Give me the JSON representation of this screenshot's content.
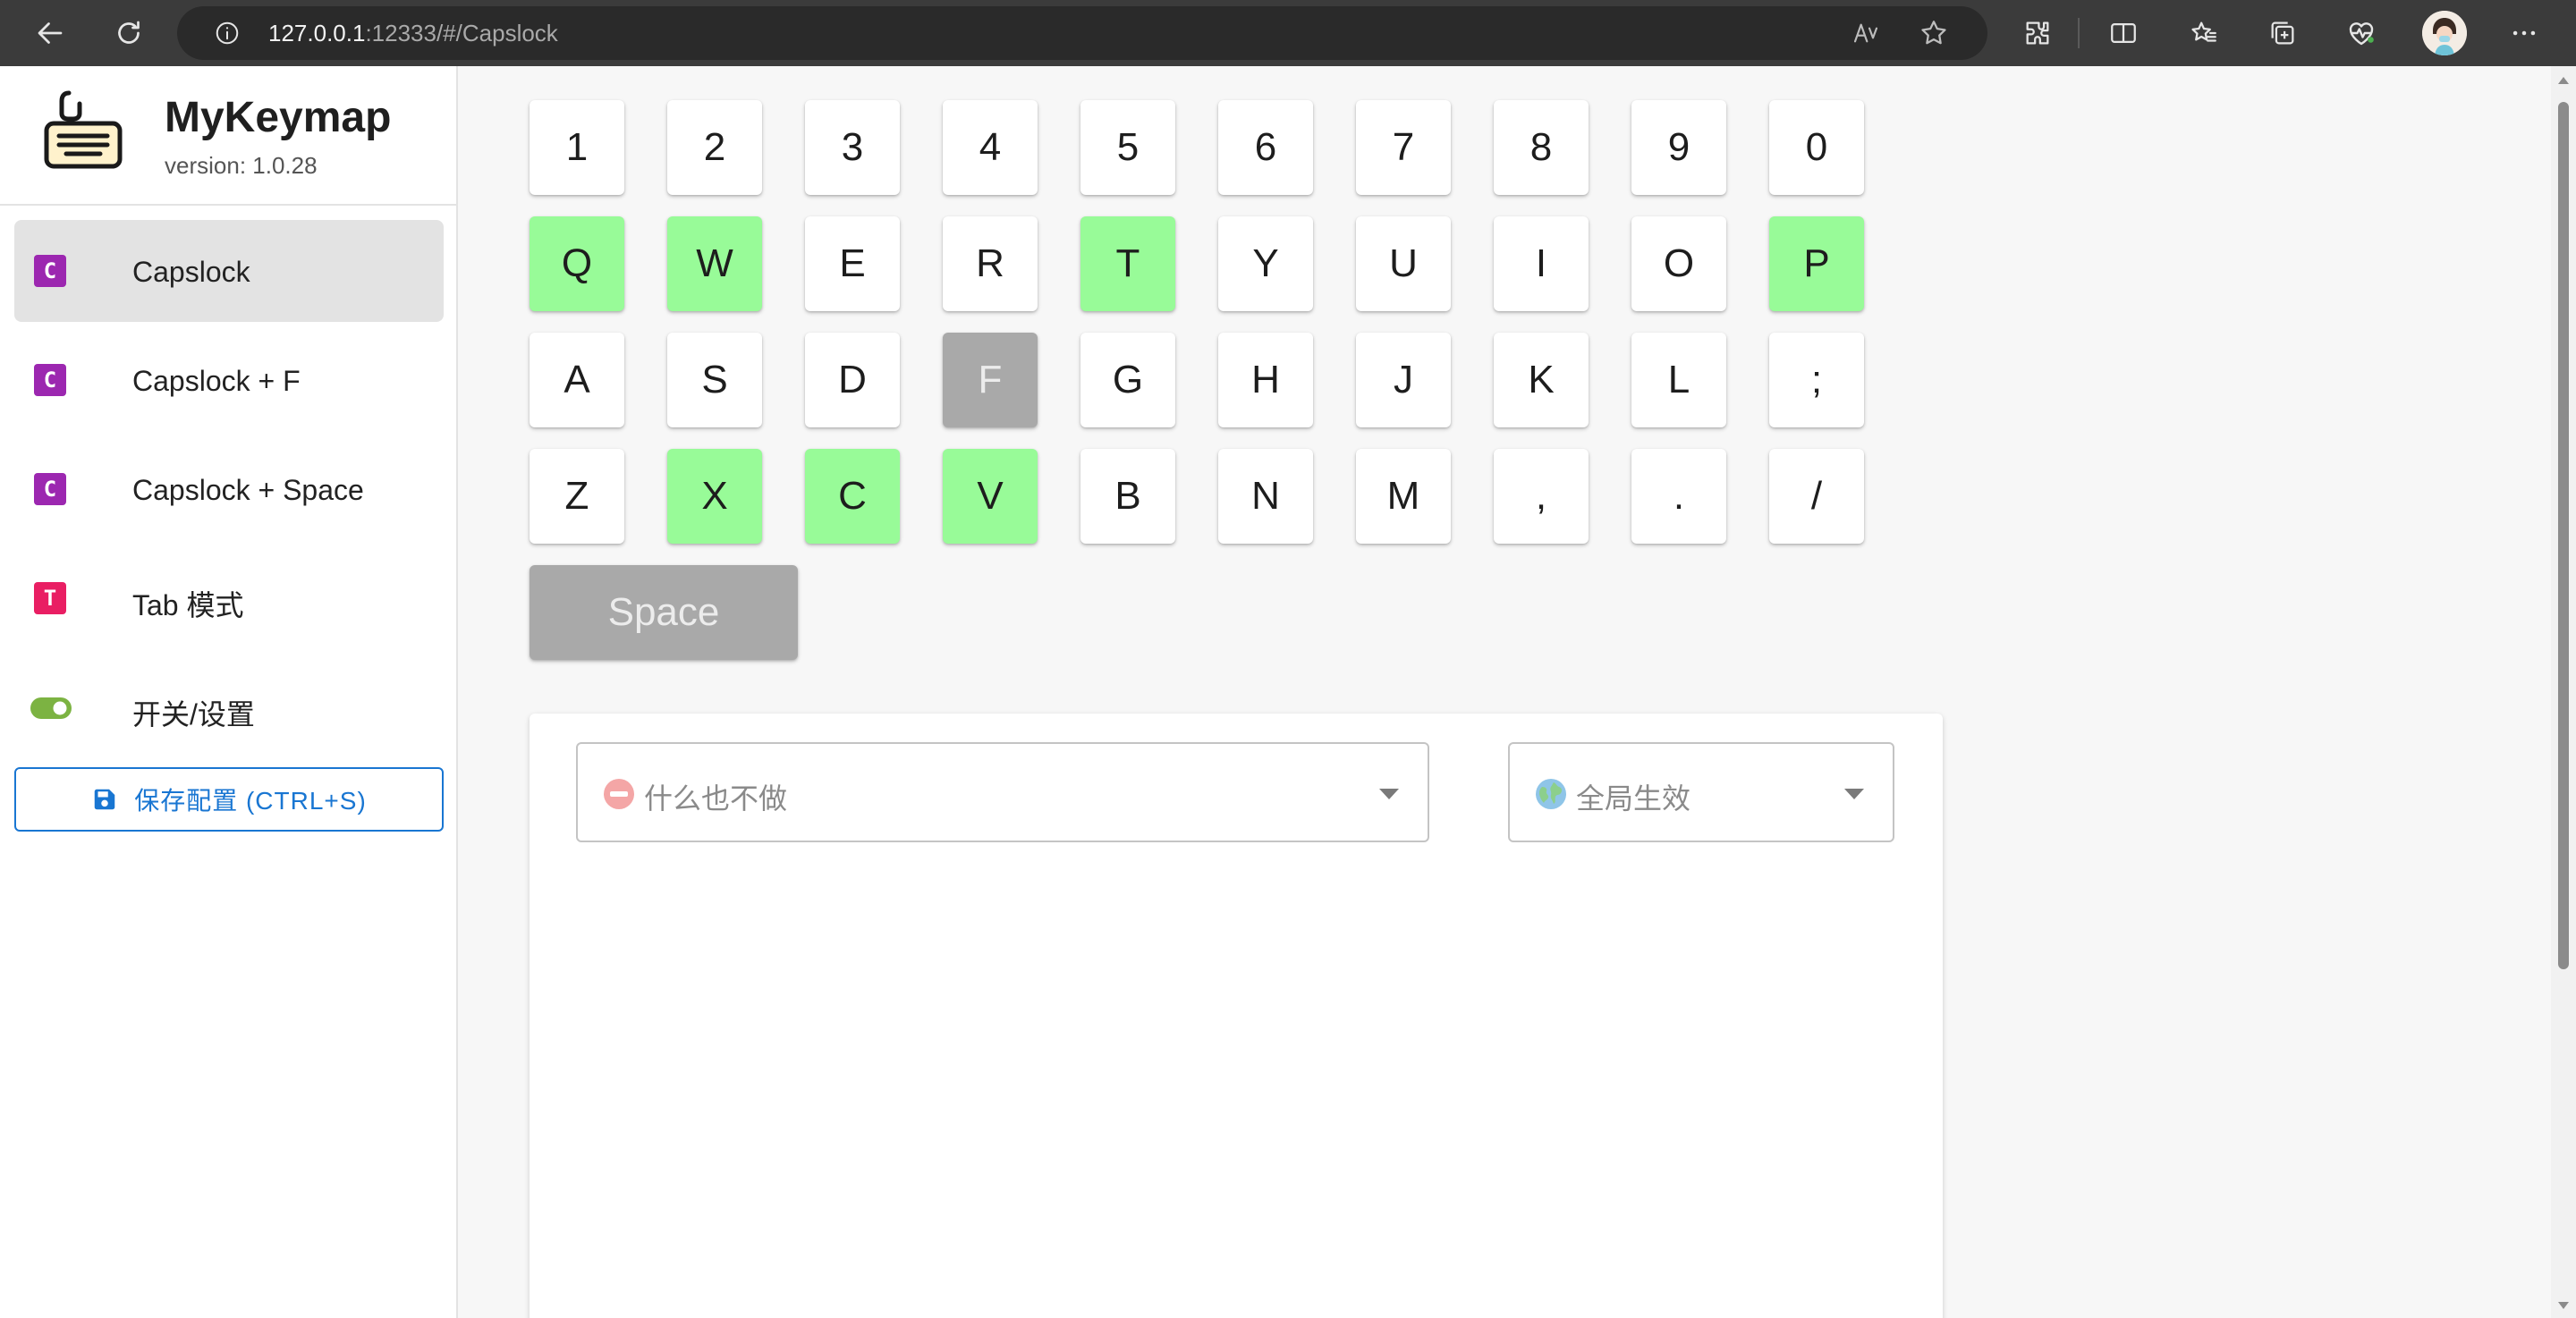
{
  "browser": {
    "url_host": "127.0.0.1",
    "url_rest": ":12333/#/Capslock"
  },
  "app": {
    "name": "MyKeymap",
    "version": "version: 1.0.28"
  },
  "menu": [
    {
      "badge": "C",
      "label": "Capslock",
      "color": "#9c27b0",
      "active": true
    },
    {
      "badge": "C",
      "label": "Capslock + F",
      "color": "#9c27b0",
      "active": false
    },
    {
      "badge": "C",
      "label": "Capslock + Space",
      "color": "#9c27b0",
      "active": false
    },
    {
      "badge": "T",
      "label": "Tab 模式",
      "color": "#e91e63",
      "active": false
    },
    {
      "badge": "",
      "label": "开关/设置",
      "color": "#7cb342",
      "active": false
    }
  ],
  "save_button": {
    "label": "保存配置 (CTRL+S)"
  },
  "keyboard": {
    "row1": [
      "1",
      "2",
      "3",
      "4",
      "5",
      "6",
      "7",
      "8",
      "9",
      "0"
    ],
    "row2": [
      "Q",
      "W",
      "E",
      "R",
      "T",
      "Y",
      "U",
      "I",
      "O",
      "P"
    ],
    "row3": [
      "A",
      "S",
      "D",
      "F",
      "G",
      "H",
      "J",
      "K",
      "L",
      ";"
    ],
    "row4": [
      "Z",
      "X",
      "C",
      "V",
      "B",
      "N",
      "M",
      ",",
      ".",
      "/"
    ],
    "space": "Space",
    "mapped_keys": [
      "Q",
      "W",
      "T",
      "P",
      "X",
      "C",
      "V"
    ],
    "selected_key": "F",
    "mapped_color": "#98fb98",
    "selected_color": "#a9a9a9"
  },
  "config": {
    "action_select": {
      "value": "什么也不做",
      "icon": "no-entry-icon"
    },
    "scope_select": {
      "value": "全局生效",
      "icon": "globe-icon"
    }
  }
}
